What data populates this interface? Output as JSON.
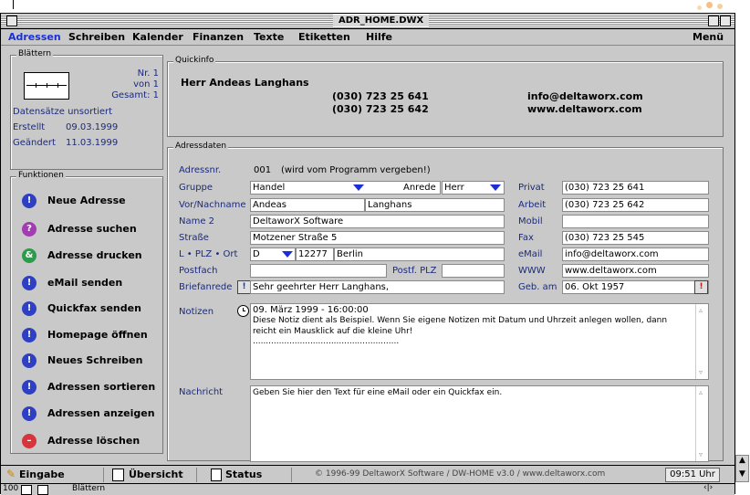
{
  "window": {
    "title": "ADR_HOME.DWX"
  },
  "menu": {
    "items": [
      "Adressen",
      "Schreiben",
      "Kalender",
      "Finanzen",
      "Texte",
      "Etiketten",
      "Hilfe"
    ],
    "right": "Menü"
  },
  "blaettern": {
    "label": "Blättern",
    "nr": "Nr. 1",
    "von": "von 1",
    "gesamt": "Gesamt: 1",
    "sort": "Datensätze unsortiert",
    "erstellt_label": "Erstellt",
    "erstellt": "09.03.1999",
    "geaendert_label": "Geändert",
    "geaendert": "11.03.1999"
  },
  "funktionen": {
    "label": "Funktionen",
    "buttons": [
      {
        "label": "Neue Adresse",
        "icon": "!",
        "color": "#2e3fc4"
      },
      {
        "label": "Adresse suchen",
        "icon": "?",
        "color": "#a23cb0"
      },
      {
        "label": "Adresse drucken",
        "icon": "&",
        "color": "#2e9a4c"
      },
      {
        "label": "eMail senden",
        "icon": "!",
        "color": "#2e3fc4"
      },
      {
        "label": "Quickfax senden",
        "icon": "!",
        "color": "#2e3fc4"
      },
      {
        "label": "Homepage öffnen",
        "icon": "!",
        "color": "#2e3fc4"
      },
      {
        "label": "Neues Schreiben",
        "icon": "!",
        "color": "#2e3fc4"
      },
      {
        "label": "Adressen sortieren",
        "icon": "!",
        "color": "#2e3fc4"
      },
      {
        "label": "Adressen anzeigen",
        "icon": "!",
        "color": "#2e3fc4"
      },
      {
        "label": "Adresse löschen",
        "icon": "–",
        "color": "#d8343c"
      }
    ]
  },
  "quickinfo": {
    "label": "Quickinfo",
    "name": "Herr Andeas Langhans",
    "phone1": "(030) 723 25 641",
    "phone2": "(030) 723 25 642",
    "email": "info@deltaworx.com",
    "web": "www.deltaworx.com"
  },
  "adressdaten": {
    "label": "Adressdaten",
    "adressnr_label": "Adressnr.",
    "adressnr": "001",
    "adressnr_hint": "(wird vom Programm vergeben!)",
    "gruppe_label": "Gruppe",
    "gruppe": "Handel",
    "anrede_label": "Anrede",
    "anrede": "Herr",
    "vorname_label": "Vor/Nachname",
    "vorname": "Andeas",
    "nachname": "Langhans",
    "name2_label": "Name 2",
    "name2": "DeltaworX Software",
    "strasse_label": "Straße",
    "strasse": "Motzener Straße 5",
    "lplzort_label": "L • PLZ • Ort",
    "land": "D",
    "plz": "12277",
    "ort": "Berlin",
    "postfach_label": "Postfach",
    "postfach": "",
    "postfplz_label": "Postf. PLZ",
    "postfplz": "",
    "briefanrede_label": "Briefanrede",
    "briefanrede": "Sehr geehrter Herr Langhans,",
    "privat_label": "Privat",
    "privat": "(030) 723 25 641",
    "arbeit_label": "Arbeit",
    "arbeit": "(030) 723 25 642",
    "mobil_label": "Mobil",
    "mobil": "",
    "fax_label": "Fax",
    "fax": "(030) 723 25 545",
    "email_label": "eMail",
    "email": "info@deltaworx.com",
    "www_label": "WWW",
    "www": "www.deltaworx.com",
    "geb_label": "Geb. am",
    "geb": "06. Okt 1957",
    "notizen_label": "Notizen",
    "notizen_line1": "09. März 1999 - 16:00:00",
    "notizen_line2": "Diese Notiz dient als Beispiel. Wenn Sie eigene Notizen mit Datum und Uhrzeit anlegen wollen, dann",
    "notizen_line3": "reicht ein Mausklick auf die kleine Uhr!",
    "notizen_line4": "........................................................",
    "nachricht_label": "Nachricht",
    "nachricht": "Geben Sie hier den Text für eine eMail oder ein Quickfax ein."
  },
  "statusbar": {
    "tab1": "Eingabe",
    "tab2": "Übersicht",
    "tab3": "Status",
    "copyright": "© 1996-99 DeltaworX Software / DW-HOME v3.0 / www.deltaworx.com",
    "time": "09:51 Uhr"
  },
  "bottom": {
    "zoom": "100",
    "mode": "Blättern"
  }
}
